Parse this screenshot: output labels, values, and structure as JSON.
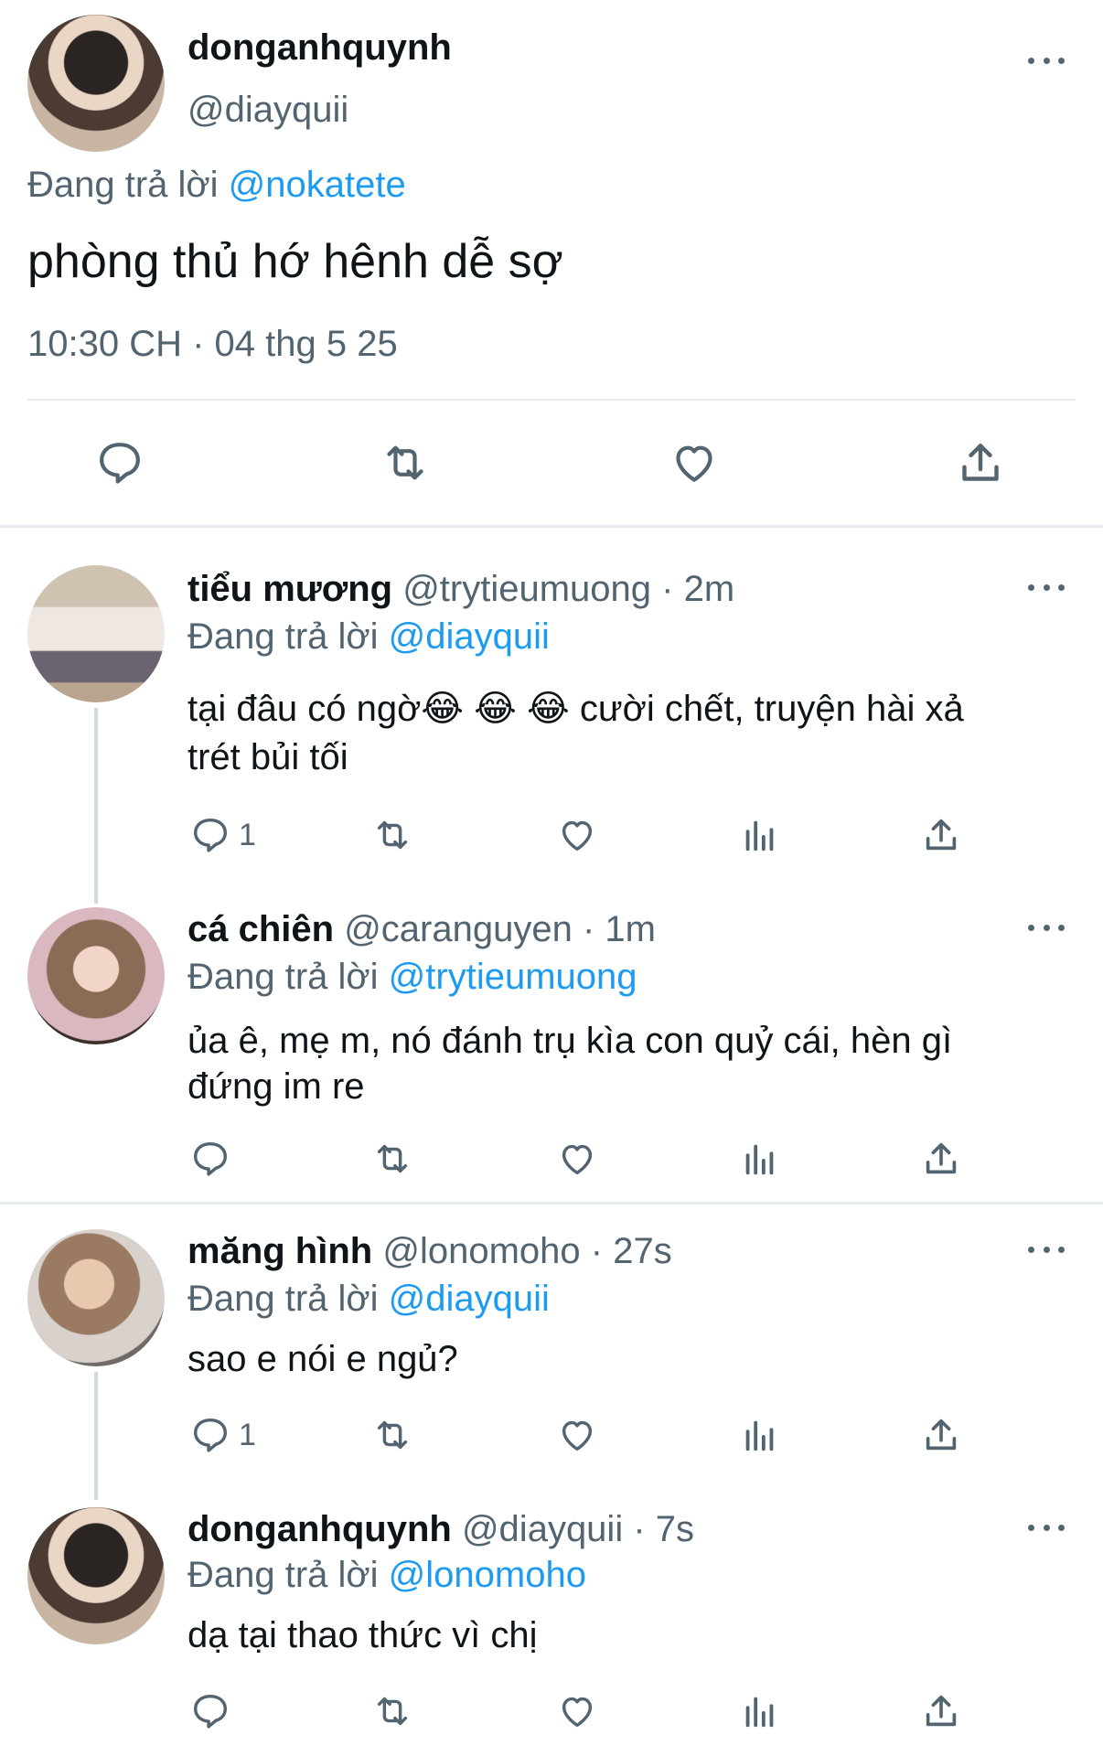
{
  "main_tweet": {
    "display_name": "donganhquynh",
    "handle": "@diayquii",
    "replying_prefix": "Đang trả lời",
    "replying_to": "@nokatete",
    "text": "phòng thủ hớ hênh dễ sợ",
    "timestamp": "10:30 CH · 04 thg 5 25"
  },
  "replies": [
    {
      "display_name": "tiểu mương",
      "handle": "@trytieumuong",
      "time": "· 2m",
      "replying_prefix": "Đang trả lời",
      "replying_to": "@diayquii",
      "text_line1": "tại đâu có ngờ😂 😂 😂  cười chết, truyện hài xả",
      "text_line2": "trét bủi tối",
      "reply_count": "1"
    },
    {
      "display_name": "cá chiên",
      "handle": "@caranguyen",
      "time": "· 1m",
      "replying_prefix": "Đang trả lời",
      "replying_to": "@trytieumuong",
      "text_line1": "ủa ê, mẹ m, nó đánh trụ kìa con quỷ cái, hèn gì",
      "text_line2": "đứng im re",
      "reply_count": ""
    },
    {
      "display_name": "măng hình",
      "handle": "@lonomoho",
      "time": "· 27s",
      "replying_prefix": "Đang trả lời",
      "replying_to": "@diayquii",
      "text_line1": "sao e nói e ngủ?",
      "reply_count": "1"
    },
    {
      "display_name": "donganhquynh",
      "handle": "@diayquii",
      "time": "· 7s",
      "replying_prefix": "Đang trả lời",
      "replying_to": "@lonomoho",
      "text_line1": "dạ tại thao thức vì chị",
      "reply_count": ""
    }
  ],
  "icons": {
    "reply": "reply-icon",
    "retweet": "retweet-icon",
    "like": "heart-icon",
    "views": "views-icon",
    "share": "share-icon",
    "more": "more-icon"
  },
  "colors": {
    "link": "#1d9bf0",
    "muted": "#536471",
    "text": "#0f1419",
    "divider": "#e6ecf0"
  }
}
